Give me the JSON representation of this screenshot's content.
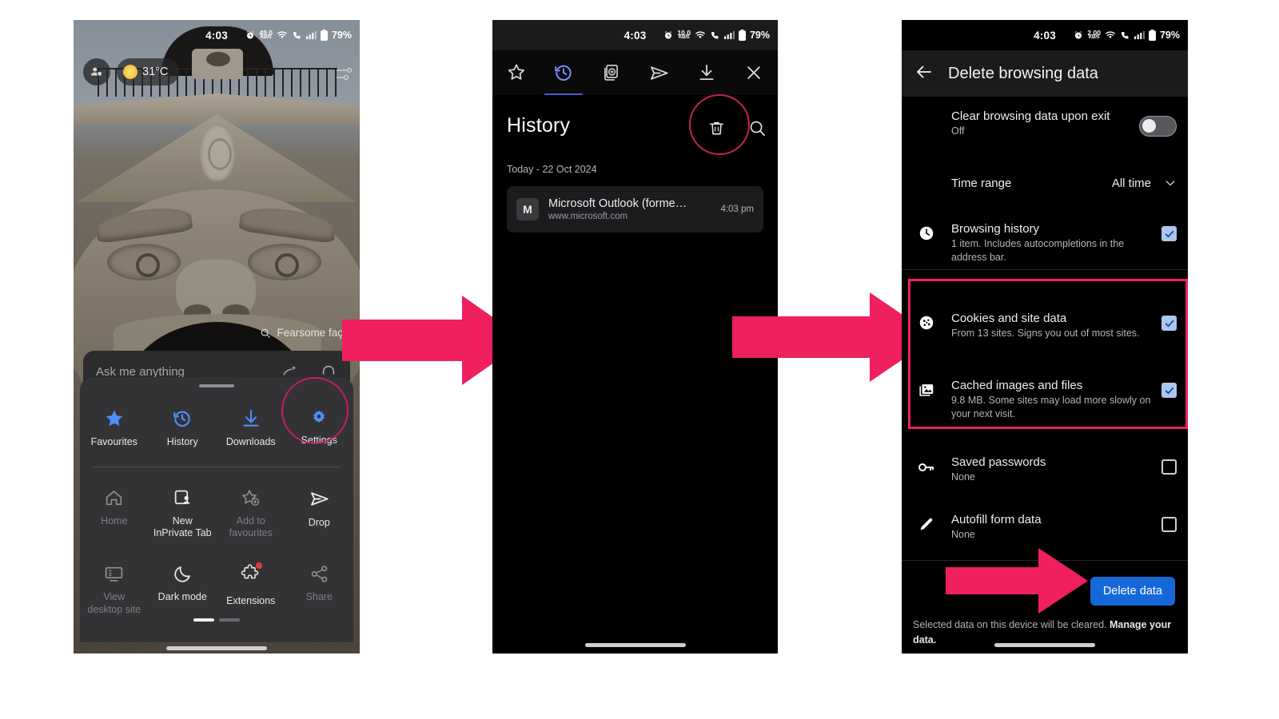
{
  "accent": {
    "pink": "#f01f5e",
    "circle_outline": "#c2215c",
    "blue_button": "#1668d8",
    "edge_blue": "#7b8bff",
    "checkbox_on": "#aac7f0"
  },
  "phone1": {
    "status": {
      "time": "4:03",
      "net_rate": "49.0",
      "net_unit": "KB/S",
      "battery": "79%"
    },
    "weather": {
      "temperature": "31°C"
    },
    "search_hint": "Fearsome façad",
    "ask_bar": {
      "placeholder": "Ask me anything"
    },
    "menu": {
      "row1": [
        {
          "label": "Favourites",
          "icon": "star-filled-icon",
          "dim": false
        },
        {
          "label": "History",
          "icon": "history-icon",
          "dim": false
        },
        {
          "label": "Downloads",
          "icon": "download-icon",
          "dim": false
        },
        {
          "label": "Settings",
          "icon": "gear-icon",
          "dim": false
        }
      ],
      "row2": [
        {
          "label": "Home",
          "icon": "home-icon",
          "dim": true
        },
        {
          "label": "New\nInPrivate Tab",
          "icon": "inprivate-tab-icon",
          "dim": false
        },
        {
          "label": "Add to\nfavourites",
          "icon": "add-to-favourites-icon",
          "dim": true
        },
        {
          "label": "Drop",
          "icon": "drop-send-icon",
          "dim": false
        }
      ],
      "row3": [
        {
          "label": "View\ndesktop site",
          "icon": "desktop-site-icon",
          "dim": true
        },
        {
          "label": "Dark mode",
          "icon": "moon-icon",
          "dim": false
        },
        {
          "label": "Extensions",
          "icon": "extensions-icon",
          "dim": false
        },
        {
          "label": "Share",
          "icon": "share-icon",
          "dim": true
        }
      ]
    }
  },
  "phone2": {
    "status": {
      "time": "4:03",
      "net_rate": "10.0",
      "net_unit": "KB/S",
      "battery": "79%"
    },
    "tabs": [
      {
        "name": "favourites",
        "icon": "star-outline-icon",
        "active": false
      },
      {
        "name": "history",
        "icon": "history-icon",
        "active": true
      },
      {
        "name": "collections",
        "icon": "collections-add-icon",
        "active": false
      },
      {
        "name": "drop",
        "icon": "drop-send-icon",
        "active": false
      },
      {
        "name": "downloads",
        "icon": "download-icon",
        "active": false
      },
      {
        "name": "close",
        "icon": "close-icon",
        "active": false
      }
    ],
    "title": "History",
    "actions": {
      "delete": "trash-icon",
      "search": "search-icon"
    },
    "date_header": "Today - 22 Oct 2024",
    "item": {
      "favicon_letter": "M",
      "title": "Microsoft Outlook (forme…",
      "url": "www.microsoft.com",
      "time": "4:03 pm"
    }
  },
  "phone3": {
    "status": {
      "time": "4:03",
      "net_rate": "2.00",
      "net_unit": "KB/S",
      "battery": "79%"
    },
    "appbar": {
      "back_icon": "back-arrow-icon",
      "title": "Delete browsing data"
    },
    "clear_on_exit": {
      "title": "Clear browsing data upon exit",
      "subtitle": "Off",
      "toggle": "off"
    },
    "time_range": {
      "label": "Time range",
      "value": "All time",
      "chevron": "chevron-down-icon"
    },
    "options": [
      {
        "icon": "clock-icon",
        "title": "Browsing history",
        "subtitle": "1 item. Includes autocompletions in the address bar.",
        "checked": true,
        "highlighted": false
      },
      {
        "icon": "cookie-icon",
        "title": "Cookies and site data",
        "subtitle": "From 13 sites. Signs you out of most sites.",
        "checked": true,
        "highlighted": true
      },
      {
        "icon": "image-icon",
        "title": "Cached images and files",
        "subtitle": "9.8 MB. Some sites may load more slowly on your next visit.",
        "checked": true,
        "highlighted": true
      },
      {
        "icon": "key-icon",
        "title": "Saved passwords",
        "subtitle": "None",
        "checked": false,
        "highlighted": false
      },
      {
        "icon": "pencil-icon",
        "title": "Autofill form data",
        "subtitle": "None",
        "checked": false,
        "highlighted": false
      }
    ],
    "delete_button": "Delete data",
    "footnote_prefix": "Selected data on this device will be cleared. ",
    "footnote_link": "Manage your data."
  },
  "annotations": {
    "arrow1": "step-arrow-1",
    "arrow2": "step-arrow-2",
    "arrow3": "step-arrow-3",
    "circle1": "settings-highlight-circle",
    "circle2": "delete-history-highlight-circle",
    "box1": "cookies-cache-highlight-box"
  }
}
